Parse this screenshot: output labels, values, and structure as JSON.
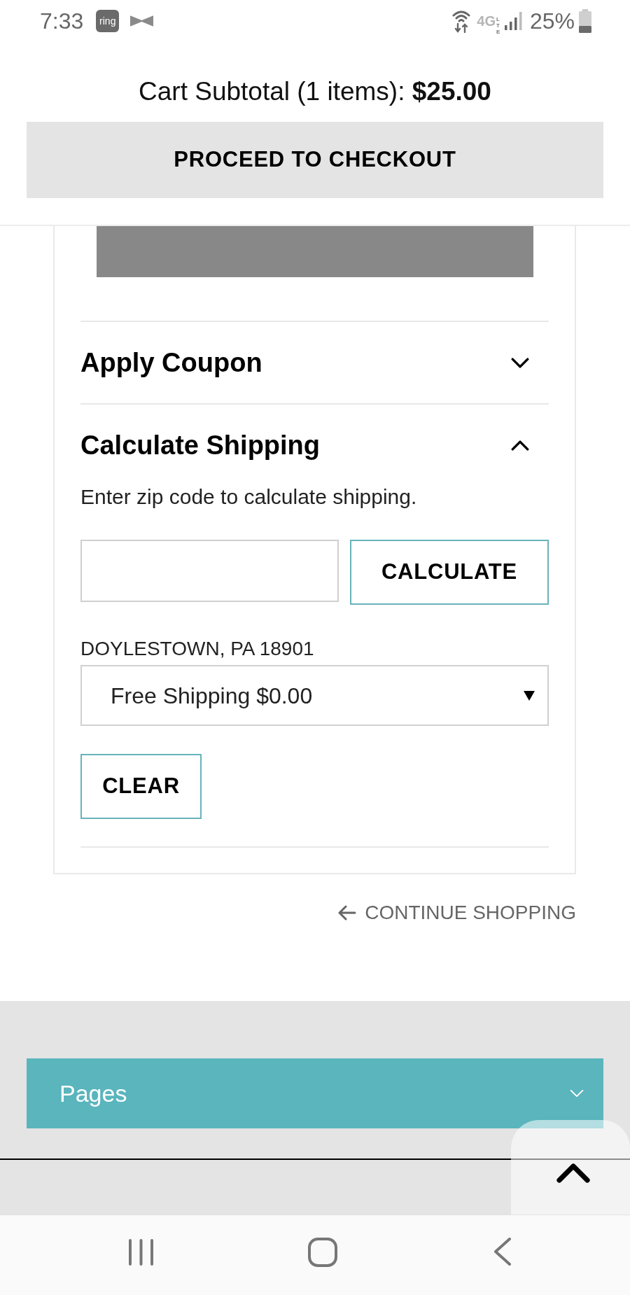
{
  "status_bar": {
    "time": "7:33",
    "app_logo": "ring",
    "network": "4G",
    "network_sub": "LTE",
    "battery": "25%"
  },
  "header": {
    "subtotal": "Cart Subtotal (1 items): **$25.00**",
    "checkout_button": "PROCEED TO CHECKOUT"
  },
  "cart": {
    "sections": [
      {
        "title": "Apply Coupon",
        "expanded": false
      },
      {
        "title": "Calculate Shipping",
        "expanded": true,
        "hint": "Enter zip code to calculate shipping.",
        "calculate_button": "CALCULATE",
        "location": "DOYLESTOWN, PA 18901",
        "shipping_option": "Free Shipping $0.00",
        "clear_button": "CLEAR"
      }
    ],
    "continue_link": "CONTINUE SHOPPING"
  },
  "footer": {
    "menu": {
      "label": "Pages",
      "expanded": false
    }
  }
}
